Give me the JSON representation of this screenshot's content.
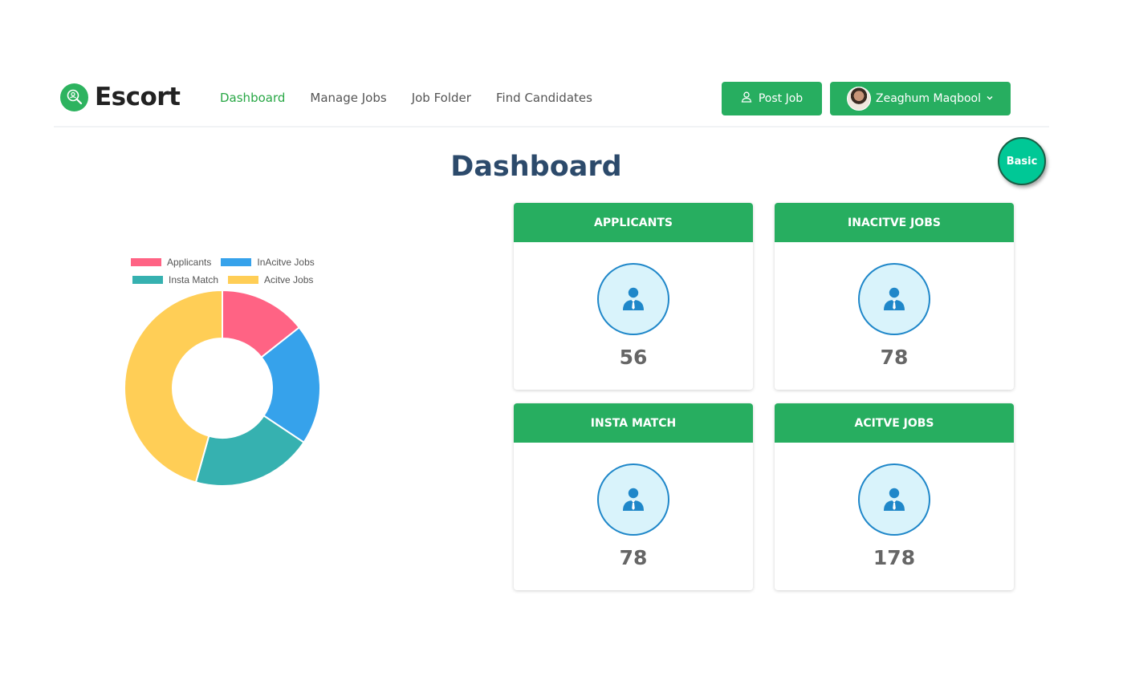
{
  "brand": {
    "name": "Escort",
    "logo_icon": "magnifier-logo-icon",
    "color": "#27ae60"
  },
  "nav": [
    {
      "label": "Dashboard",
      "active": true
    },
    {
      "label": "Manage Jobs",
      "active": false
    },
    {
      "label": "Job Folder",
      "active": false
    },
    {
      "label": "Find Candidates",
      "active": false
    }
  ],
  "header": {
    "post_job_label": "Post Job",
    "post_job_icon": "user-icon",
    "user_name": "Zeaghum Maqbool",
    "user_menu_icon": "chevron-down-icon"
  },
  "plan_badge": "Basic",
  "page_title": "Dashboard",
  "cards": [
    {
      "title": "APPLICANTS",
      "value": "56",
      "icon": "person-icon"
    },
    {
      "title": "INACITVE JOBS",
      "value": "78",
      "icon": "person-icon"
    },
    {
      "title": "INSTA MATCH",
      "value": "78",
      "icon": "person-icon"
    },
    {
      "title": "ACITVE JOBS",
      "value": "178",
      "icon": "person-icon"
    }
  ],
  "chart_data": {
    "type": "doughnut",
    "legend_position": "top",
    "categories": [
      "Applicants",
      "InAcitve Jobs",
      "Insta Match",
      "Acitve Jobs"
    ],
    "values": [
      56,
      78,
      78,
      178
    ],
    "colors": [
      "#ff6384",
      "#36a2eb",
      "#36b1b0",
      "#ffce56"
    ]
  }
}
